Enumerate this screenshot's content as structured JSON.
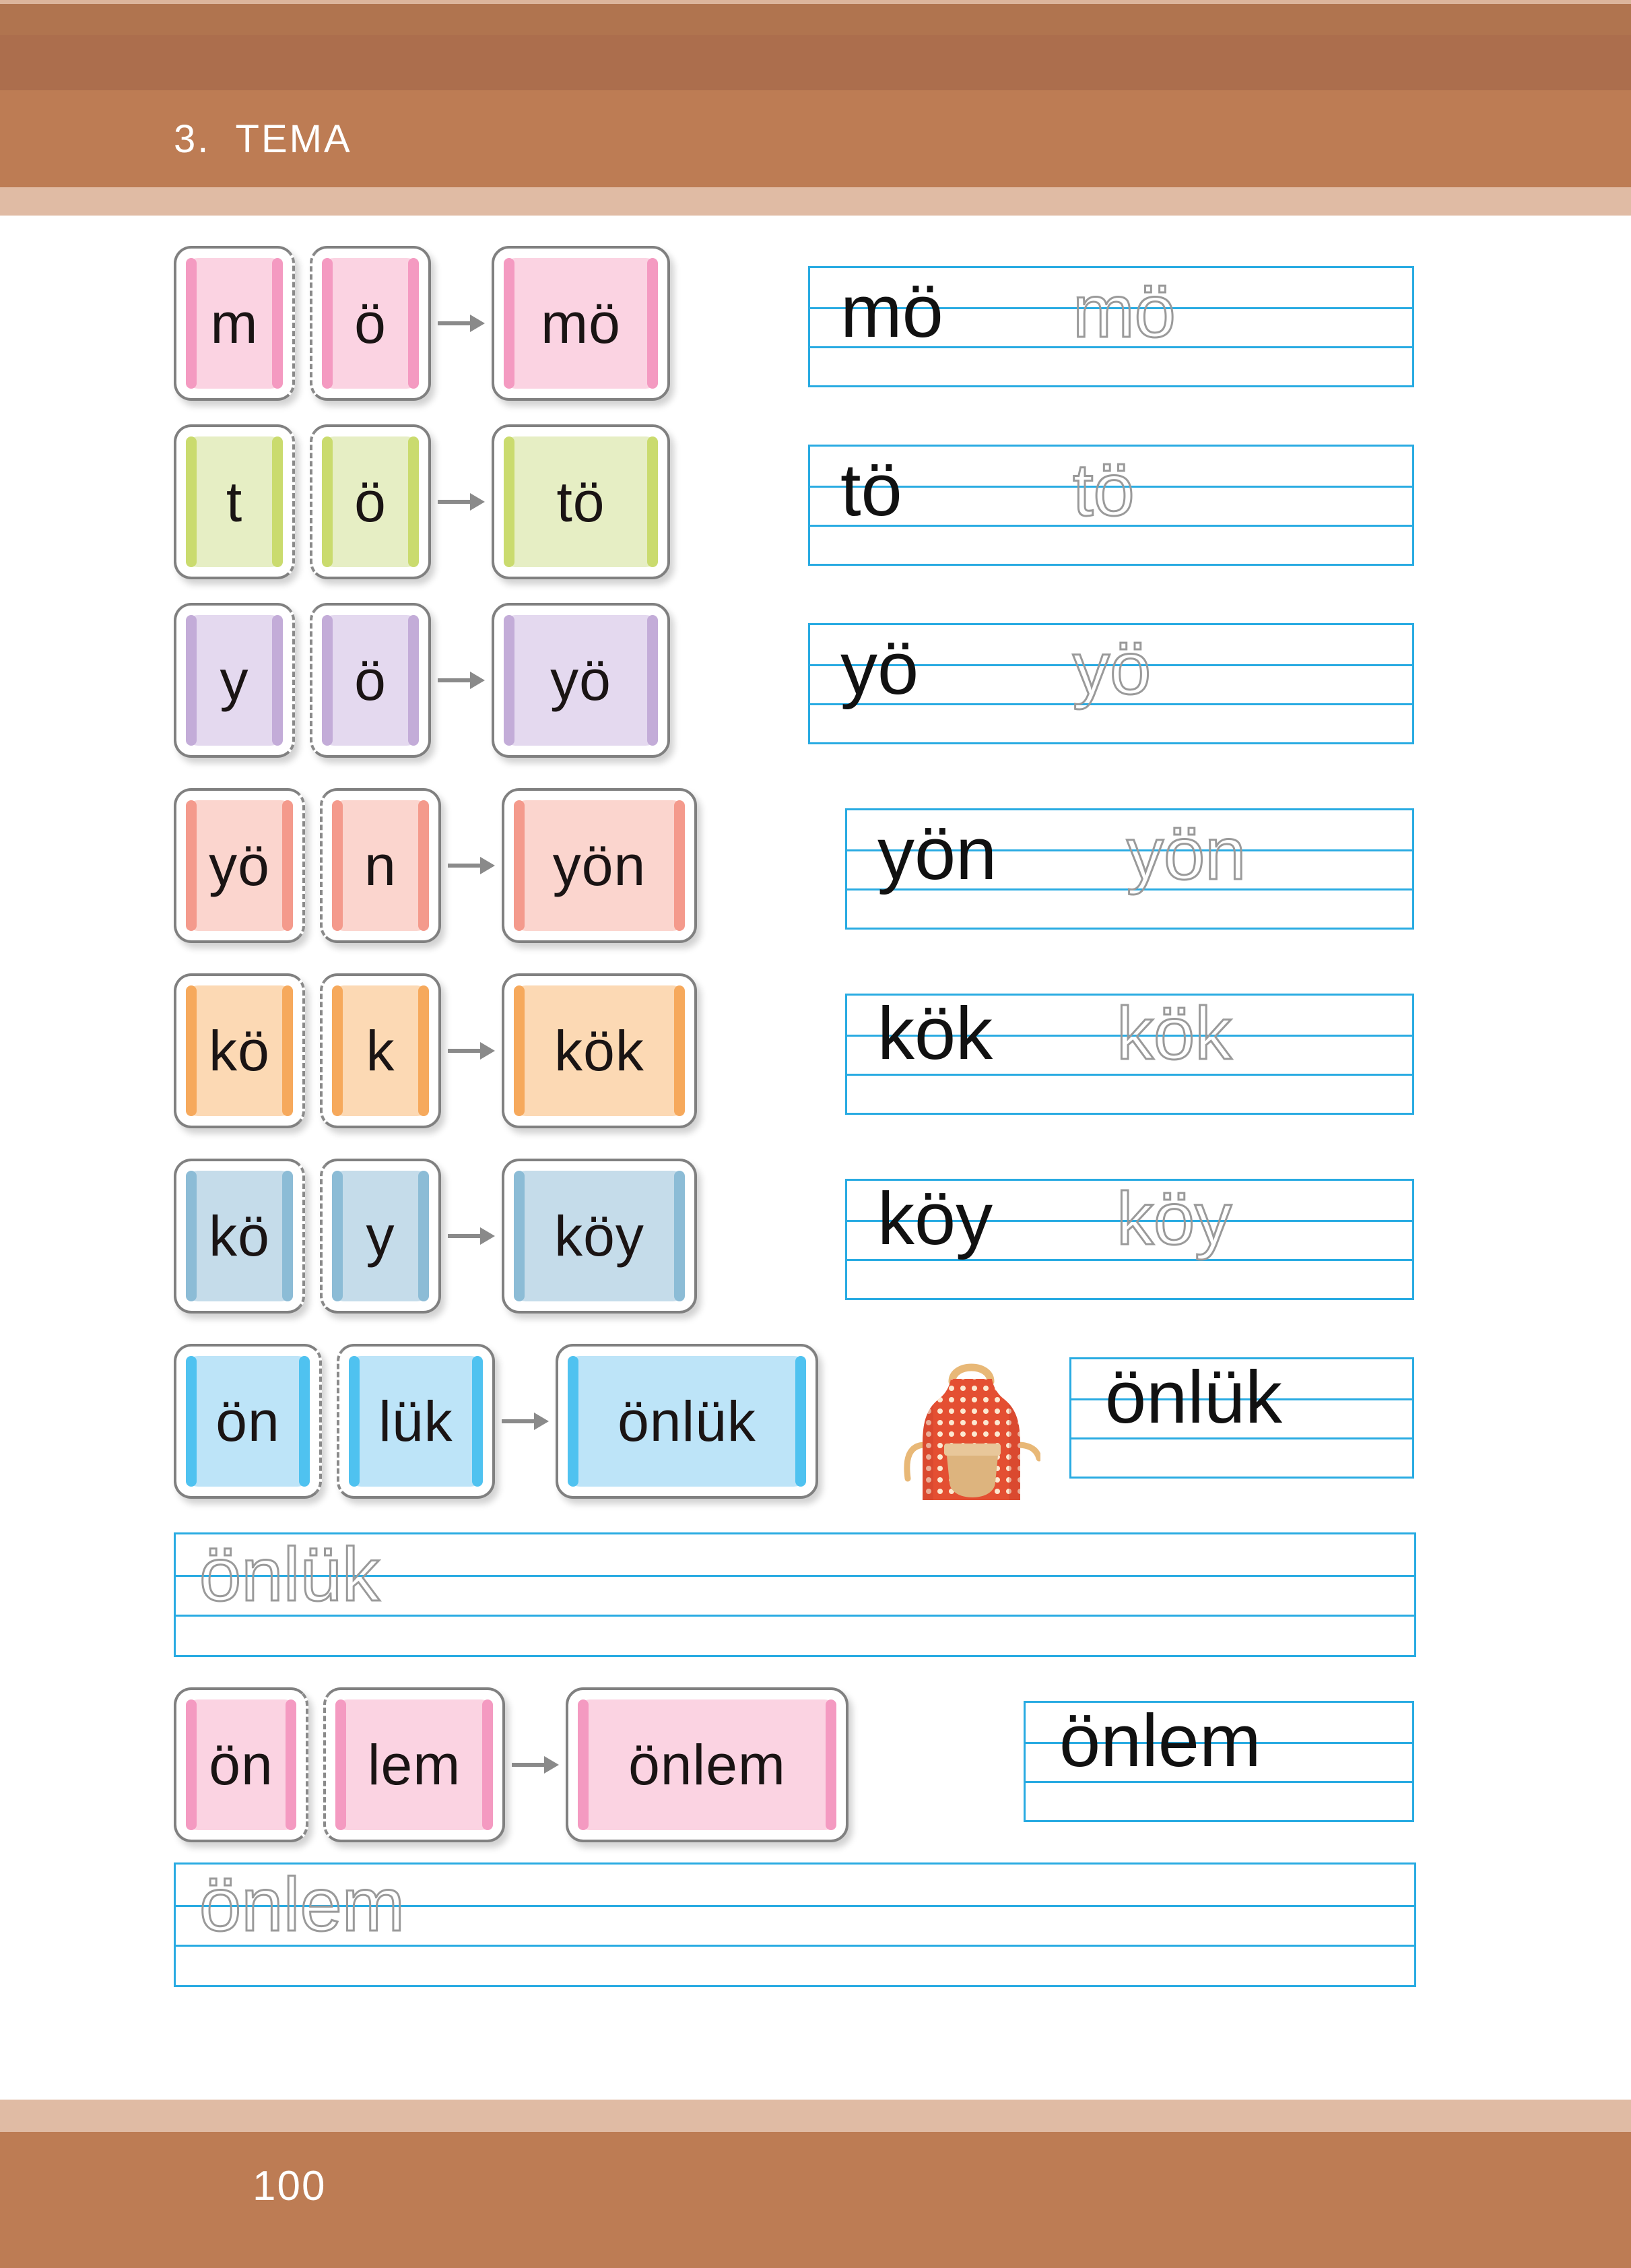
{
  "header": {
    "title": "3.  TEMA",
    "bg_dark": "#ac6e4d",
    "bg_mid": "#bd7c54",
    "bg_light": "#e0bba4",
    "text_color": "#ffffff"
  },
  "footer": {
    "page_number": "100",
    "bg_dark": "#bd7c54",
    "bg_light": "#e0bba4",
    "text_color": "#ffffff"
  },
  "line_color": "#29abe2",
  "card_border_color": "#808080",
  "trace_color": "#8f8f8f",
  "arrow_color": "#8a8a8a",
  "rows": [
    {
      "id": "row-mo",
      "parts": [
        "m",
        "ö"
      ],
      "result": "mö",
      "fill": "#fbd3e2",
      "edge": "#f49ac1",
      "practice_solid": "mö",
      "practice_dotted": "mö"
    },
    {
      "id": "row-to",
      "parts": [
        "t",
        "ö"
      ],
      "result": "tö",
      "fill": "#e6eec4",
      "edge": "#cadb6e",
      "practice_solid": "tö",
      "practice_dotted": "tö"
    },
    {
      "id": "row-yo",
      "parts": [
        "y",
        "ö"
      ],
      "result": "yö",
      "fill": "#e4d9ef",
      "edge": "#c3acd8",
      "practice_solid": "yö",
      "practice_dotted": "yö"
    },
    {
      "id": "row-yon",
      "parts": [
        "yö",
        "n"
      ],
      "result": "yön",
      "fill": "#fbd5ce",
      "edge": "#f49a8c",
      "practice_solid": "yön",
      "practice_dotted": "yön"
    },
    {
      "id": "row-kok",
      "parts": [
        "kö",
        "k"
      ],
      "result": "kök",
      "fill": "#fcd9b4",
      "edge": "#f6a95c",
      "practice_solid": "kök",
      "practice_dotted": "kök"
    },
    {
      "id": "row-koy",
      "parts": [
        "kö",
        "y"
      ],
      "result": "köy",
      "fill": "#c5dcea",
      "edge": "#8cbcd6",
      "practice_solid": "köy",
      "practice_dotted": "köy"
    },
    {
      "id": "row-onluk",
      "parts": [
        "ön",
        "lük"
      ],
      "result": "önlük",
      "fill": "#bde4f8",
      "edge": "#4fc2f0",
      "practice_solid": "önlük",
      "practice_dotted": "",
      "illustration": "apron-icon"
    },
    {
      "id": "row-onlem",
      "parts": [
        "ön",
        "lem"
      ],
      "result": "önlem",
      "fill": "#fbd3e2",
      "edge": "#f49ac1",
      "practice_solid": "önlem",
      "practice_dotted": ""
    }
  ],
  "full_practice_lines": [
    {
      "id": "practice-onluk",
      "dotted": "önlük"
    },
    {
      "id": "practice-onlem",
      "dotted": "önlem"
    }
  ],
  "apron": {
    "body_color": "#e44f32",
    "dot_color": "#fdf0d9",
    "strap_color": "#e8b877",
    "pocket_color": "#ddb47e"
  }
}
